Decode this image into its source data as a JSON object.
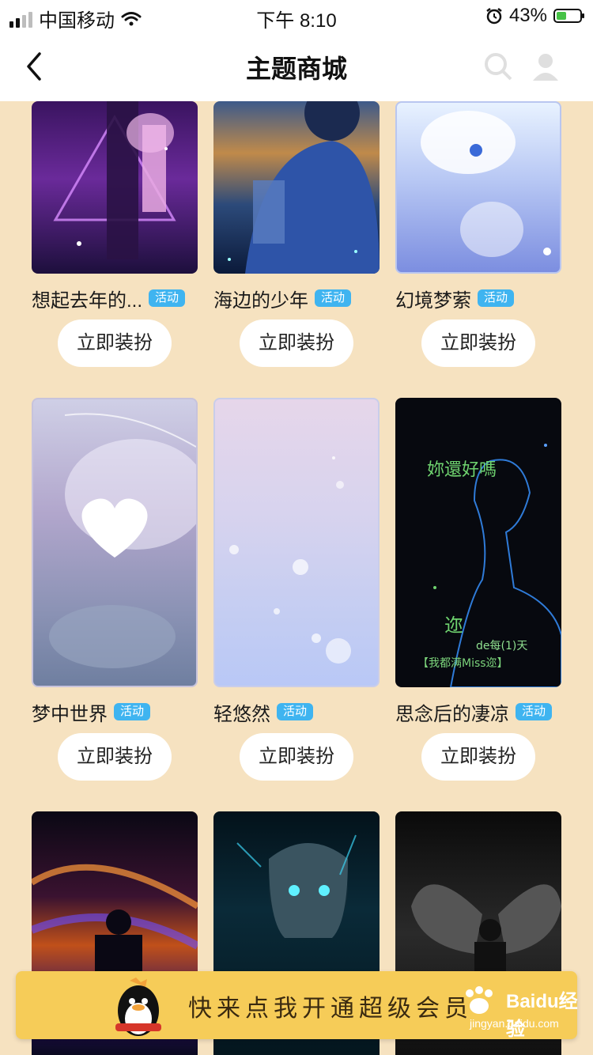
{
  "status_bar": {
    "carrier": "中国移动",
    "time": "下午 8:10",
    "battery": "43%"
  },
  "nav": {
    "title": "主题商城"
  },
  "themes": [
    {
      "name": "想起去年的...",
      "badge": "活动",
      "button": "立即装扮"
    },
    {
      "name": "海边的少年",
      "badge": "活动",
      "button": "立即装扮"
    },
    {
      "name": "幻境梦萦",
      "badge": "活动",
      "button": "立即装扮"
    },
    {
      "name": "梦中世界",
      "badge": "活动",
      "button": "立即装扮"
    },
    {
      "name": "轻悠然",
      "badge": "活动",
      "button": "立即装扮"
    },
    {
      "name": "思念后的凄凉",
      "badge": "活动",
      "button": "立即装扮"
    },
    {
      "name": "",
      "badge": "",
      "button": ""
    },
    {
      "name": "",
      "badge": "",
      "button": ""
    },
    {
      "name": "",
      "badge": "",
      "button": ""
    }
  ],
  "thumb_art": {
    "t5_line1": "妳還好嗎",
    "t5_line2": "迩",
    "t5_line3": "de每(1)天",
    "t5_line4": "【我都满Miss迩】"
  },
  "vip_bar": {
    "text": "快来点我开通超级会员"
  },
  "watermark": {
    "brand": "Baidu经验",
    "url": "jingyan.baidu.com"
  },
  "colors": {
    "background": "#f6e2c0",
    "badge": "#3fb4f0",
    "vip_bar": "#f6cc58"
  }
}
